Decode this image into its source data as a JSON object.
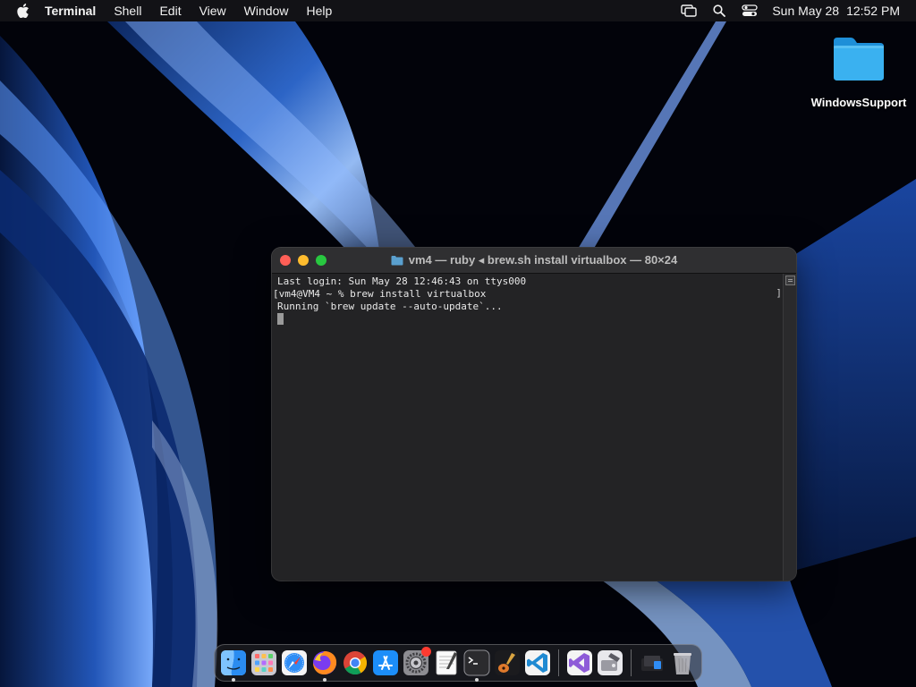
{
  "menubar": {
    "app_name": "Terminal",
    "menus": [
      "Shell",
      "Edit",
      "View",
      "Window",
      "Help"
    ],
    "date": "Sun May 28",
    "time": "12:52 PM",
    "status_icons": [
      "screen-mirroring-icon",
      "search-icon",
      "control-center-icon"
    ]
  },
  "desktop": {
    "folder_label": "WindowsSupport"
  },
  "terminal": {
    "title": "vm4 — ruby ◂ brew.sh install virtualbox — 80×24",
    "lines": [
      "Last login: Sun May 28 12:46:43 on ttys000",
      "vm4@VM4 ~ % brew install virtualbox",
      "Running `brew update --auto-update`..."
    ],
    "line_prefix": "[",
    "line_suffix": "]"
  },
  "dock": {
    "apps": [
      {
        "name": "finder-icon",
        "running": true
      },
      {
        "name": "launchpad-icon",
        "running": false
      },
      {
        "name": "safari-icon",
        "running": false
      },
      {
        "name": "firefox-icon",
        "running": true
      },
      {
        "name": "chrome-icon",
        "running": false
      },
      {
        "name": "app-store-icon",
        "running": false
      },
      {
        "name": "system-settings-icon",
        "running": false,
        "badge": true
      },
      {
        "name": "textedit-icon",
        "running": false
      },
      {
        "name": "terminal-icon",
        "running": true
      },
      {
        "name": "garageband-icon",
        "running": false
      },
      {
        "name": "vscode-icon",
        "running": false
      }
    ],
    "extras": [
      {
        "name": "visual-studio-icon",
        "running": false
      },
      {
        "name": "disk-utility-icon",
        "running": false
      }
    ],
    "trailing": [
      {
        "name": "downloads-stack-icon"
      },
      {
        "name": "trash-icon"
      }
    ]
  },
  "colors": {
    "close": "#ff5f57",
    "minimize": "#febc2e",
    "zoom": "#28c840",
    "terminal_bg": "#232325",
    "folder": "#3ab1f0"
  }
}
